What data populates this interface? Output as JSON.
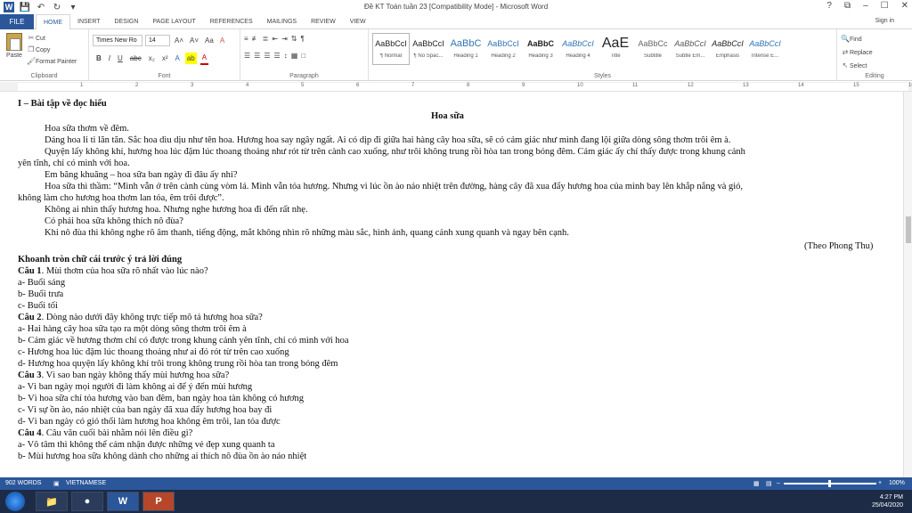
{
  "window": {
    "title": "Đề KT Toán tuần 23 [Compatibility Mode] - Microsoft Word",
    "help": "?",
    "restore": "⧉",
    "minimize": "–",
    "maximize": "☐",
    "close": "✕"
  },
  "tabs": {
    "file": "FILE",
    "items": [
      "HOME",
      "INSERT",
      "DESIGN",
      "PAGE LAYOUT",
      "REFERENCES",
      "MAILINGS",
      "REVIEW",
      "VIEW"
    ],
    "signin": "Sign in"
  },
  "ribbon": {
    "clipboard": {
      "paste": "Paste",
      "cut": "Cut",
      "copy": "Copy",
      "format_painter": "Format Painter",
      "label": "Clipboard"
    },
    "font": {
      "name": "Times New Ro",
      "size": "14",
      "label": "Font",
      "bold": "B",
      "italic": "I",
      "underline": "U",
      "strike": "abc",
      "subscript": "x₂",
      "superscript": "x²",
      "grow": "A˄",
      "shrink": "A˅",
      "case": "Aa",
      "clear": "A",
      "effects": "A",
      "highlight": "ab",
      "color": "A"
    },
    "paragraph": {
      "label": "Paragraph"
    },
    "styles": {
      "label": "Styles",
      "items": [
        {
          "sample": "AaBbCcI",
          "name": "¶ Normal"
        },
        {
          "sample": "AaBbCcI",
          "name": "¶ No Spac..."
        },
        {
          "sample": "AaBbC",
          "name": "Heading 1"
        },
        {
          "sample": "AaBbCcI",
          "name": "Heading 2"
        },
        {
          "sample": "AaBbC",
          "name": "Heading 3"
        },
        {
          "sample": "AaBbCcI",
          "name": "Heading 4"
        },
        {
          "sample": "AaE",
          "name": "Title"
        },
        {
          "sample": "AaBbCc",
          "name": "Subtitle"
        },
        {
          "sample": "AaBbCcI",
          "name": "Subtle Em..."
        },
        {
          "sample": "AaBbCcI",
          "name": "Emphasis"
        },
        {
          "sample": "AaBbCcI",
          "name": "Intense E..."
        }
      ]
    },
    "editing": {
      "find": "Find",
      "replace": "Replace",
      "select": "Select",
      "label": "Editing"
    }
  },
  "ruler": [
    "1",
    "2",
    "3",
    "4",
    "5",
    "6",
    "7",
    "8",
    "9",
    "10",
    "11",
    "12",
    "13",
    "14",
    "15",
    "16"
  ],
  "document": {
    "lines": [
      "I – Bài tập về đọc hiểu",
      "Hoa sữa",
      "Hoa sữa thơm về đêm.",
      "Dáng hoa li ti lăn tăn. Sắc hoa dìu dịu như tên hoa. Hương hoa say ngây ngất. Ai có dịp đi giữa hai hàng cây hoa sữa, sẽ có cảm giác như mình đang lội giữa dòng sông thơm trôi êm à.",
      "Quyện lấy không khí, hương hoa lúc đậm lúc thoang thoảng như rót từ trên cành cao xuống, như trôi không trung rồi hòa tan trong bóng đêm. Cảm giác ấy chỉ thấy được trong khung cảnh",
      "yên tĩnh, chỉ có mình với hoa.",
      "Em băng khuăng – hoa sữa ban ngày đi đâu ấy nhỉ?",
      "Hoa sữa thì thầm: “Mình vẫn ở trên cành cùng vòm lá. Mình vẫn tỏa hương. Nhưng vì lúc ồn ào náo nhiệt trên đường, hàng cây đã xua đẩy hương hoa của mình bay lên khắp nắng và gió,",
      "không làm cho hương hoa thơm lan tỏa, êm trôi được”.",
      "Không ai nhìn thấy hương hoa. Nhưng nghe hương hoa đi đến rất nhẹ.",
      "Có phải hoa sữa không thích nô đùa?",
      "Khi nô đùa thì không nghe rõ âm thanh, tiếng động, mắt không nhìn rõ những màu sắc, hình ảnh, quang cảnh xung quanh và ngay bên cạnh.",
      "(Theo Phong Thu)",
      "Khoanh tròn chữ cái trước ý trả lời đúng",
      "Câu 1",
      ". Mùi thơm của hoa sữa rõ nhất vào lúc nào?",
      "a- Buổi sáng",
      "b- Buổi trưa",
      "c- Buổi tối",
      "Câu 2",
      ". Dòng nào dưới đây không trực tiếp mô tả hương hoa sữa?",
      "a- Hai hàng cây hoa sữa tạo ra một dòng sông thơm trôi êm à",
      "b- Cảm giác về hương thơm chỉ có được trong khung cảnh yên tĩnh, chỉ có mình với hoa",
      "c- Hương hoa lúc đậm lúc thoang thoảng như ai đó rót từ trên cao xuống",
      "d- Hương hoa quyện lấy không khí trôi trong không trung rồi hòa tan trong bóng đêm",
      "Câu 3",
      ". Vì sao ban ngày không thấy mùi hương hoa sữa?",
      "a- Vì ban ngày mọi người đi làm không ai để ý đến mùi hương",
      "b- Vì hoa sữa chỉ tỏa hương vào ban đêm, ban ngày hoa tàn không có hương",
      "c- Vì sự ồn ào, náo nhiệt của ban ngày đã xua đẩy hương hoa bay đi",
      "d- Vì ban ngày có gió thổi làm hương hoa không êm trôi, lan tỏa được",
      "Câu 4",
      ". Câu văn cuối bài nhằm nói lên điều gì?",
      "a- Vô tâm thì không thể cảm nhận được những vẻ đẹp xung quanh ta",
      "b- Mùi hương hoa sữa không dành cho những ai thích nô đùa ồn ào náo nhiệt"
    ]
  },
  "status": {
    "words": "902 WORDS",
    "language": "VIETNAMESE",
    "zoom": "100%",
    "zoom_minus": "–",
    "zoom_plus": "+"
  },
  "taskbar": {
    "word_app": "W",
    "ppt_app": "P",
    "time": "4:27 PM",
    "date": "25/04/2020"
  }
}
